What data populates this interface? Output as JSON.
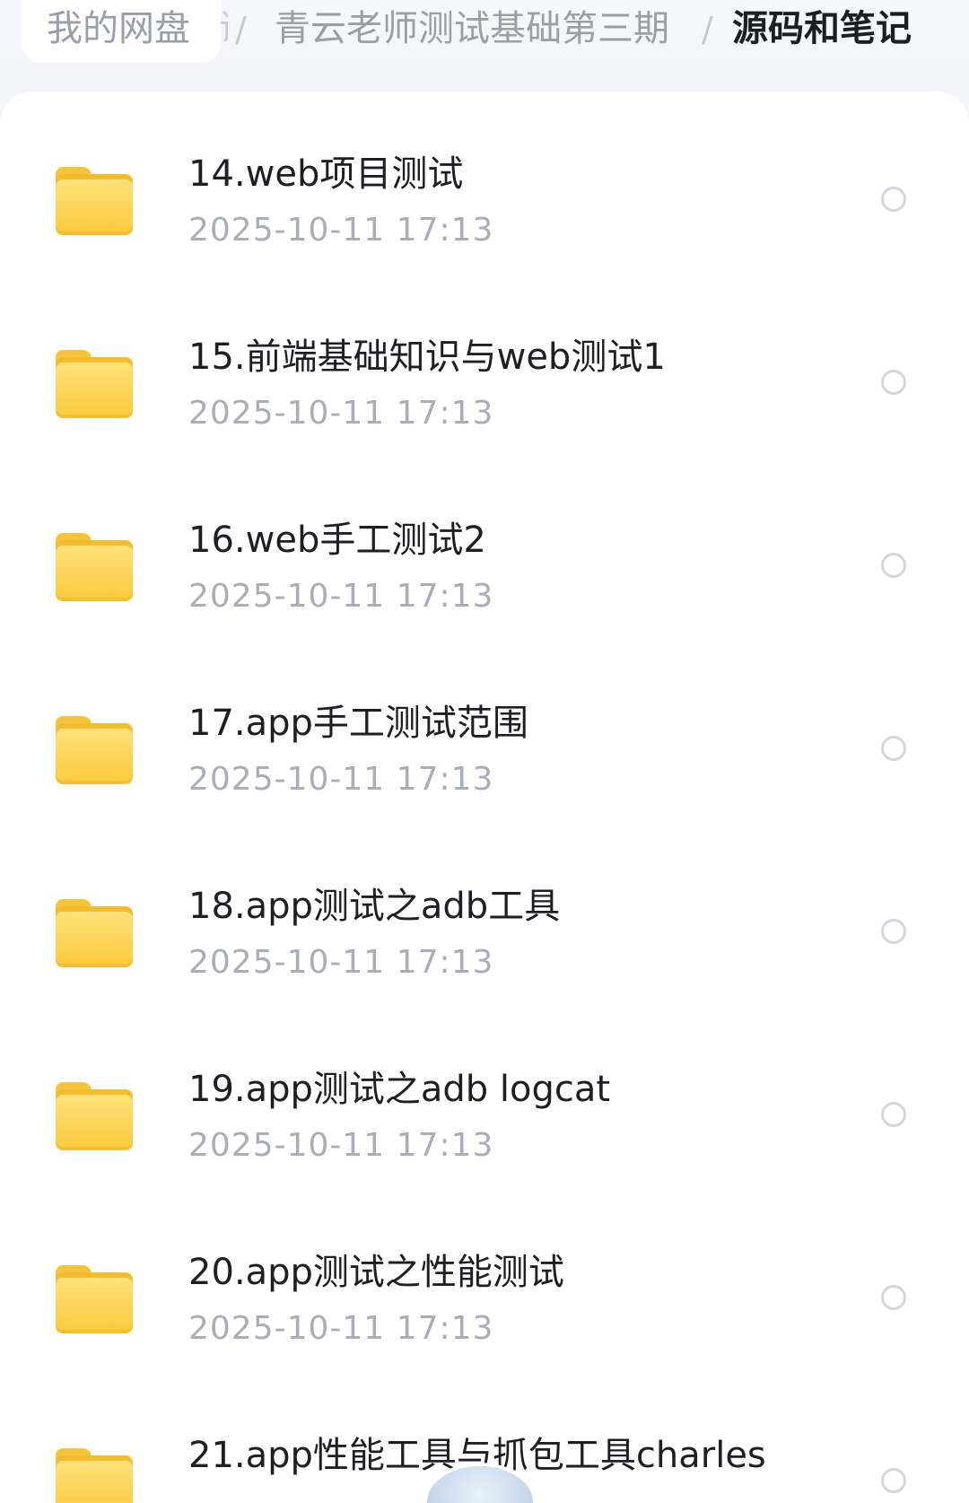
{
  "breadcrumb": {
    "root": "我的网盘",
    "truncated": "课",
    "separator": "/",
    "middle": "青云老师测试基础第三期",
    "current": "源码和笔记"
  },
  "files": [
    {
      "name": "14.web项目测试",
      "date": "2025-10-11  17:13"
    },
    {
      "name": "15.前端基础知识与web测试1",
      "date": "2025-10-11  17:13"
    },
    {
      "name": "16.web手工测试2",
      "date": "2025-10-11  17:13"
    },
    {
      "name": "17.app手工测试范围",
      "date": "2025-10-11  17:13"
    },
    {
      "name": "18.app测试之adb工具",
      "date": "2025-10-11  17:13"
    },
    {
      "name": "19.app测试之adb logcat",
      "date": "2025-10-11  17:13"
    },
    {
      "name": "20.app测试之性能测试",
      "date": "2025-10-11  17:13"
    },
    {
      "name": "21.app性能工具与抓包工具charles",
      "date": ""
    }
  ],
  "icons": {
    "folder": "folder-icon",
    "select": "radio-circle-icon"
  },
  "colors": {
    "folder": "#fcca3c",
    "text_primary": "#1d1f23",
    "text_secondary": "#a9adb5"
  }
}
